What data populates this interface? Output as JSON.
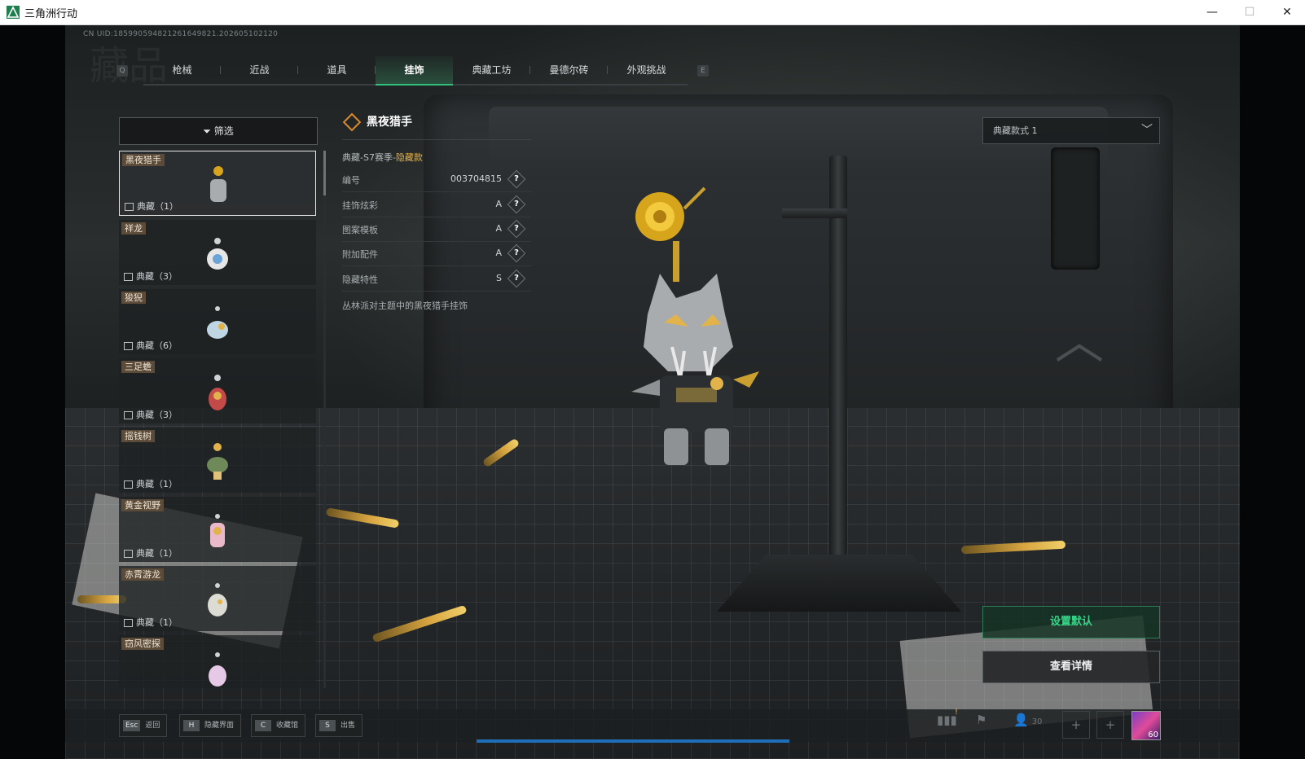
{
  "window": {
    "title": "三角洲行动",
    "min_label": "—",
    "max_label": "☐",
    "close_label": "✕"
  },
  "uid": "CN UID:1859905948212616498​21.202605102120",
  "tabs": {
    "left_key": "Q",
    "right_key": "E",
    "items": [
      {
        "label": "枪械"
      },
      {
        "label": "近战"
      },
      {
        "label": "道具"
      },
      {
        "label": "挂饰",
        "active": true
      },
      {
        "label": "典藏工坊"
      },
      {
        "label": "曼德尔砖"
      },
      {
        "label": "外观挑战"
      }
    ]
  },
  "filter": {
    "label": "筛选",
    "icon": "filter-icon"
  },
  "items": [
    {
      "name": "黑夜猎手",
      "count": "典藏（1）",
      "selected": true
    },
    {
      "name": "祥龙",
      "count": "典藏（3）"
    },
    {
      "name": "狻猊",
      "count": "典藏（6）"
    },
    {
      "name": "三足蟾",
      "count": "典藏（3）"
    },
    {
      "name": "摇钱树",
      "count": "典藏（1）"
    },
    {
      "name": "黄金视野",
      "count": "典藏（1）"
    },
    {
      "name": "赤霄游龙",
      "count": "典藏（1）"
    },
    {
      "name": "窃风密探",
      "count": ""
    }
  ],
  "detail": {
    "title": "黑夜猎手",
    "season_prefix": "典藏-S7赛季-",
    "season_tag": "隐藏款",
    "rows": [
      {
        "key": "编号",
        "value": "003704815"
      },
      {
        "key": "挂饰炫彩",
        "value": "A"
      },
      {
        "key": "图案模板",
        "value": "A"
      },
      {
        "key": "附加配件",
        "value": "A"
      },
      {
        "key": "隐藏特性",
        "value": "S"
      }
    ],
    "help_label": "?",
    "description": "丛林派对主题中的黑夜猎手挂饰"
  },
  "style_select": {
    "value": "典藏款式 1",
    "icon": "chevron-down-icon"
  },
  "actions": {
    "set_default": "设置默认",
    "view_details": "查看详情"
  },
  "hints": [
    {
      "key": "Esc",
      "label": "返回"
    },
    {
      "key": "H",
      "label": "隐藏界面"
    },
    {
      "key": "C",
      "label": "收藏馆"
    },
    {
      "key": "S",
      "label": "出售"
    }
  ],
  "status": {
    "friends_count": "30",
    "level": "60",
    "notice": "!"
  },
  "colors": {
    "accent": "#2fbf7a",
    "gold": "#e2b24b",
    "tag_bg": "#5b4b38"
  }
}
